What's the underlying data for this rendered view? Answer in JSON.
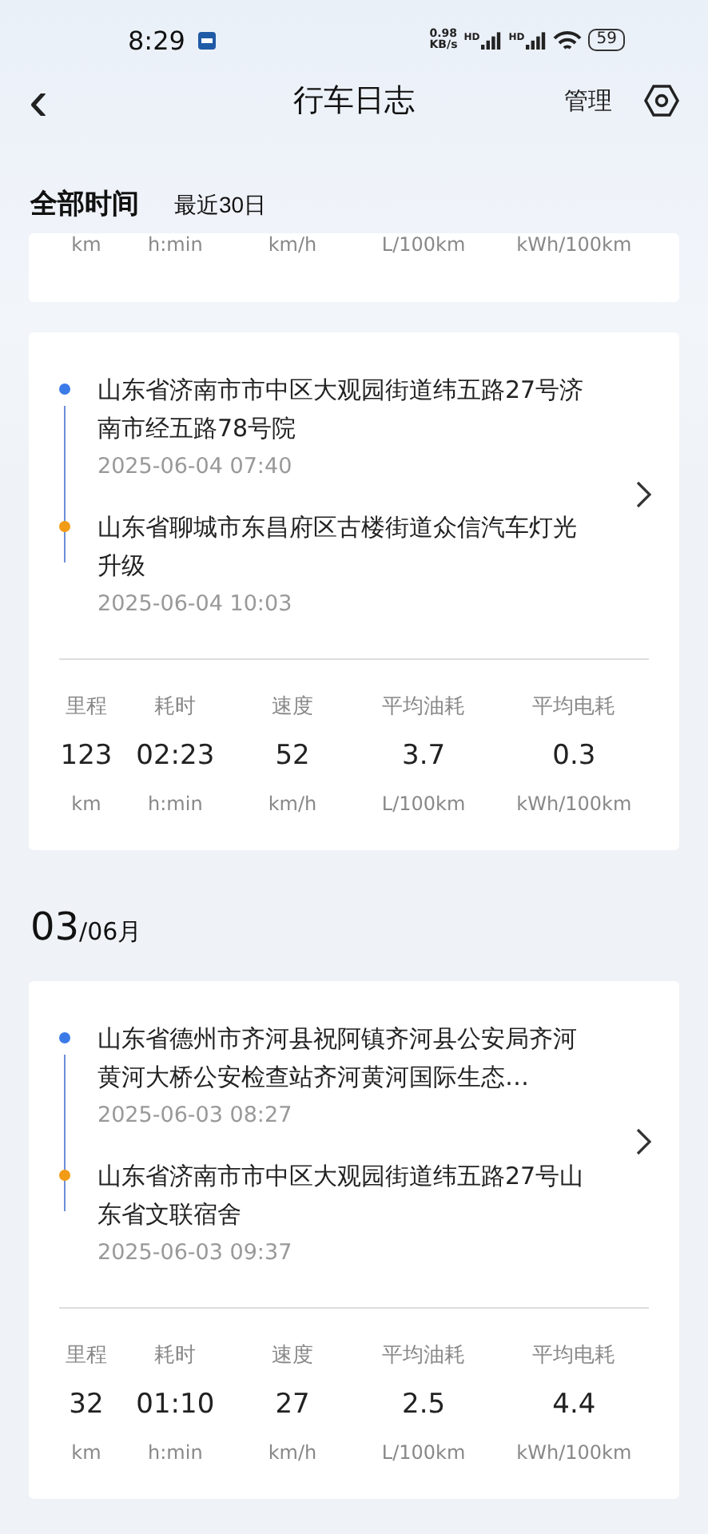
{
  "status_bar": {
    "time": "8:29",
    "speed_value": "0.98",
    "speed_unit": "KB/s",
    "signal_labels": [
      "HD",
      "HD"
    ],
    "battery": "59"
  },
  "header": {
    "back": "‹",
    "title": "行车日志",
    "manage": "管理"
  },
  "filters": [
    {
      "label": "全部时间",
      "selected": true
    },
    {
      "label": "最近30日",
      "selected": false
    }
  ],
  "partial_card": {
    "units": [
      "km",
      "h:min",
      "km/h",
      "L/100km",
      "kWh/100km"
    ]
  },
  "groups": [
    {
      "trips": [
        {
          "start": {
            "address": "山东省济南市市中区大观园街道纬五路27号济南市经五路78号院",
            "time": "2025-06-04 07:40"
          },
          "end": {
            "address": "山东省聊城市东昌府区古楼街道众信汽车灯光升级",
            "time": "2025-06-04 10:03"
          },
          "stats": [
            {
              "label": "里程",
              "value": "123",
              "unit": "km"
            },
            {
              "label": "耗时",
              "value": "02:23",
              "unit": "h:min"
            },
            {
              "label": "速度",
              "value": "52",
              "unit": "km/h"
            },
            {
              "label": "平均油耗",
              "value": "3.7",
              "unit": "L/100km"
            },
            {
              "label": "平均电耗",
              "value": "0.3",
              "unit": "kWh/100km"
            }
          ]
        }
      ]
    },
    {
      "day": "03",
      "month": "/06月",
      "trips": [
        {
          "start": {
            "address": "山东省德州市齐河县祝阿镇齐河县公安局齐河黄河大桥公安检查站齐河黄河国际生态…",
            "time": "2025-06-03 08:27"
          },
          "end": {
            "address": "山东省济南市市中区大观园街道纬五路27号山东省文联宿舍",
            "time": "2025-06-03 09:37"
          },
          "stats": [
            {
              "label": "里程",
              "value": "32",
              "unit": "km"
            },
            {
              "label": "耗时",
              "value": "01:10",
              "unit": "h:min"
            },
            {
              "label": "速度",
              "value": "27",
              "unit": "km/h"
            },
            {
              "label": "平均油耗",
              "value": "2.5",
              "unit": "L/100km"
            },
            {
              "label": "平均电耗",
              "value": "4.4",
              "unit": "kWh/100km"
            }
          ]
        }
      ]
    }
  ]
}
